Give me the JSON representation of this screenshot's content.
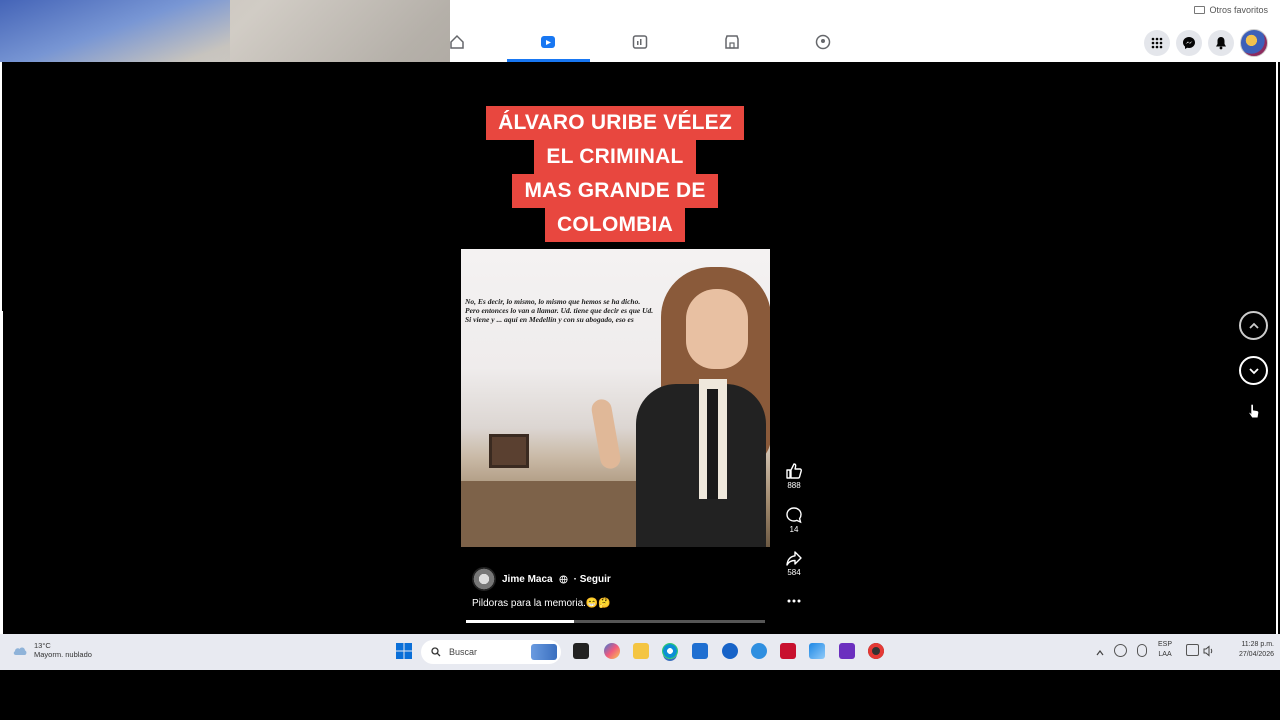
{
  "topbar": {
    "favorites_label": "Otros favoritos"
  },
  "reel": {
    "title_lines": [
      "ÁLVARO URIBE VÉLEZ",
      "EL CRIMINAL",
      "MAS GRANDE DE",
      "COLOMBIA"
    ],
    "doc_text": "No, Es decir, lo mismo, lo mismo que hemos se ha dicho. Pero entonces lo van a llamar. Ud. tiene que decir es que Ud. Si viene y ... aquí en Medellín y con su abogado, eso es",
    "likes": "888",
    "comments": "14",
    "shares": "584",
    "author_name": "Jime Maca",
    "follow_label": "· Seguir",
    "caption": "Pildoras para la memoria.😁🤔",
    "progress_fraction": 0.36
  },
  "taskbar": {
    "weather_temp": "13°C",
    "weather_desc": "Mayorm. nublado",
    "search_placeholder": "Buscar",
    "lang_top": "ESP",
    "lang_bottom": "LAA",
    "time": "11:28 p.m.",
    "date": "27/04/2026"
  },
  "colors": {
    "accent": "#1877f2",
    "title_bg": "#e8473f"
  }
}
